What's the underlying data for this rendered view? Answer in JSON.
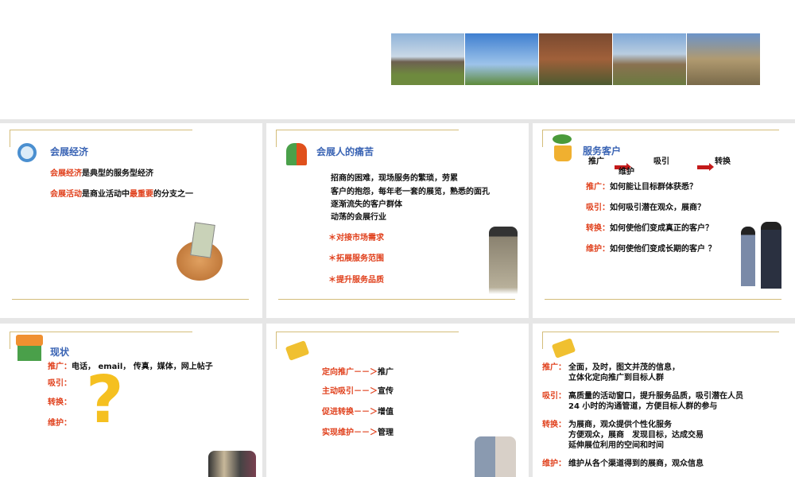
{
  "photos": [
    "stonehenge",
    "eiffel-tower",
    "aqueduct",
    "stone-bridge",
    "castle-wall"
  ],
  "card1": {
    "title": "会展经济",
    "l1a": "会展经济",
    "l1b": "是典型的服务型经济",
    "l2a": "会展活动",
    "l2b": "是商业活动中",
    "l2c": "最重要",
    "l2d": "的分支之一"
  },
  "card2": {
    "title": "会展人的痛苦",
    "lines": [
      "招商的困难，现场服务的繁琐，劳累",
      "客户的抱怨，每年老一套的展览，熟悉的面孔",
      "逐渐流失的客户群体",
      "动荡的会展行业"
    ],
    "bullets": [
      "＊对接市场需求",
      "＊拓展服务范围",
      "＊提升服务品质"
    ]
  },
  "card3": {
    "title": "服务客户",
    "flow": [
      "推广",
      "吸引",
      "转换",
      "维护"
    ],
    "items": [
      {
        "k": "推广：",
        "v": "如何能让目标群体获悉？"
      },
      {
        "k": "吸引：",
        "v": "如何吸引潜在观众，展商？"
      },
      {
        "k": "转换：",
        "v": "如何使他们变成真正的客户？"
      },
      {
        "k": "维护：",
        "v": "如何使他们变成长期的客户 ？"
      }
    ]
  },
  "card4": {
    "title": "现状",
    "items": [
      {
        "k": "推广：",
        "v": "电话， email， 传真，媒体，网上帖子"
      },
      {
        "k": "吸引：",
        "v": ""
      },
      {
        "k": "转换：",
        "v": ""
      },
      {
        "k": "维护：",
        "v": ""
      }
    ],
    "mark": "?"
  },
  "card5": {
    "items": [
      {
        "k": "定向推广－－＞",
        "v": "推广"
      },
      {
        "k": "主动吸引－－＞",
        "v": "宣传"
      },
      {
        "k": "促进转换－－＞",
        "v": "增值"
      },
      {
        "k": "实现维护－－＞",
        "v": "管理"
      }
    ]
  },
  "card6": {
    "items": [
      {
        "k": "推广：",
        "v": [
          "全面，及时，图文并茂的信息，",
          "立体化定向推广到目标人群"
        ]
      },
      {
        "k": "吸引：",
        "v": [
          "高质量的活动窗口，提升服务品质，吸引潜在人员",
          "24 小时的沟通管道，方便目标人群的参与"
        ]
      },
      {
        "k": "转换：",
        "v": [
          "为展商，观众提供个性化服务",
          "方便观众，展商　发现目标，达成交易",
          "延伸展位利用的空间和时间"
        ]
      },
      {
        "k": "维护：",
        "v": [
          "维护从各个渠道得到的展商，观众信息"
        ]
      }
    ]
  }
}
